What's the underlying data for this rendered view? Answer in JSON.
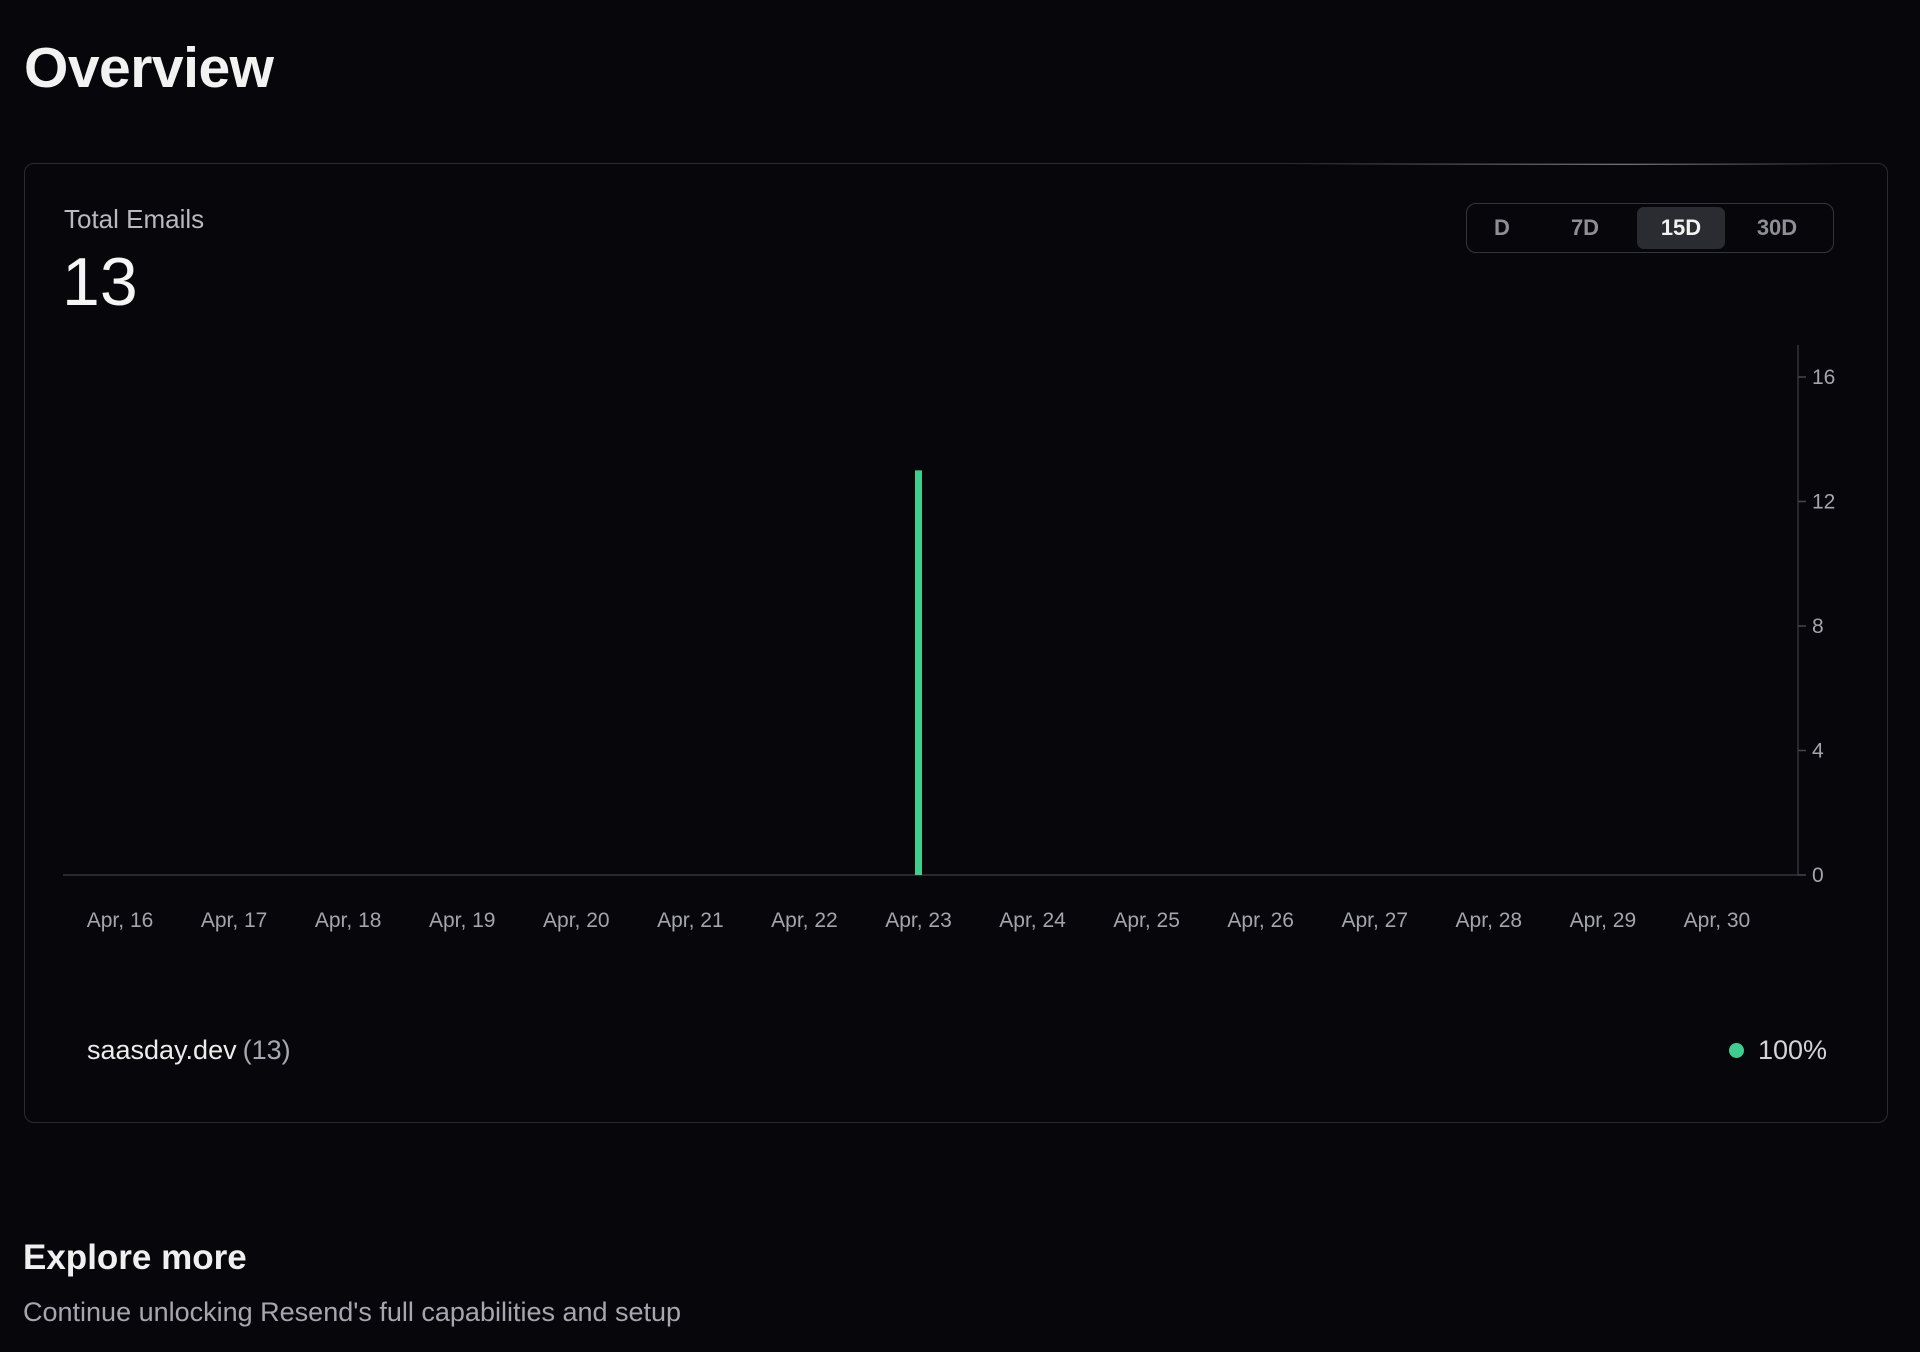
{
  "page": {
    "title": "Overview"
  },
  "summary": {
    "label": "Total Emails",
    "value": "13"
  },
  "range_toggle": {
    "options": [
      "D",
      "7D",
      "15D",
      "30D"
    ],
    "selected": "15D"
  },
  "colors": {
    "accent": "#3ecf8e",
    "background": "#07070b"
  },
  "chart_data": {
    "type": "bar",
    "title": "",
    "xlabel": "",
    "ylabel": "",
    "categories": [
      "Apr, 16",
      "Apr, 17",
      "Apr, 18",
      "Apr, 19",
      "Apr, 20",
      "Apr, 21",
      "Apr, 22",
      "Apr, 23",
      "Apr, 24",
      "Apr, 25",
      "Apr, 26",
      "Apr, 27",
      "Apr, 28",
      "Apr, 29",
      "Apr, 30"
    ],
    "series": [
      {
        "values": [
          0,
          0,
          0,
          0,
          0,
          0,
          0,
          13,
          0,
          0,
          0,
          0,
          0,
          0,
          0
        ],
        "color": "#3ecf8e"
      }
    ],
    "ylim": [
      0,
      16
    ],
    "yticks": [
      0,
      4,
      8,
      12,
      16
    ],
    "y_axis_position": "right",
    "grid": false
  },
  "legend": {
    "domain": "saasday.dev",
    "count": "(13)",
    "percent": "100%"
  },
  "explore": {
    "title": "Explore more",
    "subtitle": "Continue unlocking Resend's full capabilities and setup"
  }
}
